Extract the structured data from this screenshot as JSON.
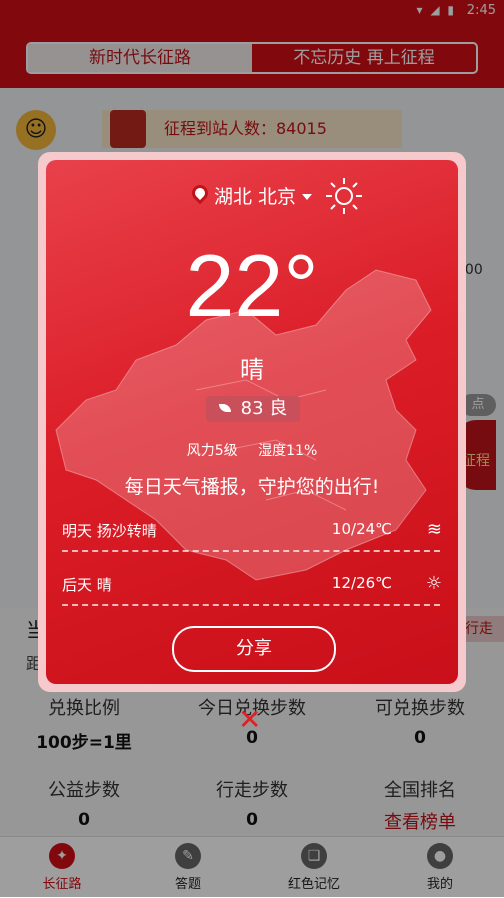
{
  "status_bar": {
    "time": "2:45",
    "icons": "▾ ◢ ▮"
  },
  "header": {
    "tabs": [
      "新时代长征路",
      "不忘历史 再上征程"
    ]
  },
  "background": {
    "arrive_text": "征程到站人数：84015",
    "side_number": "000",
    "side_dot": "点",
    "side_badge": "征程",
    "start_pill": "行走",
    "current_label": "当",
    "distance_label": "距"
  },
  "weather": {
    "location": "湖北 北京",
    "temperature": "22°",
    "condition": "晴",
    "aqi": "83 良",
    "wind": "风力5级",
    "humidity": "湿度11%",
    "slogan": "每日天气播报，守护您的出行!",
    "forecast": [
      {
        "day": "明天  扬沙转晴",
        "range": "10/24℃",
        "icon": "sand-wind-icon"
      },
      {
        "day": "后天  晴",
        "range": "12/26℃",
        "icon": "sun-icon"
      }
    ],
    "share_label": "分享"
  },
  "stats": [
    {
      "label": "兑换比例",
      "value": "100步=1里"
    },
    {
      "label": "今日兑换步数",
      "value": "0"
    },
    {
      "label": "可兑换步数",
      "value": "0"
    },
    {
      "label": "公益步数",
      "value": "0"
    },
    {
      "label": "行走步数",
      "value": "0"
    },
    {
      "label": "全国排名",
      "link": "查看榜单"
    }
  ],
  "tabbar": [
    {
      "label": "长征路",
      "color": "#d10f16"
    },
    {
      "label": "答题",
      "color": "#555555"
    },
    {
      "label": "红色记忆",
      "color": "#555555"
    },
    {
      "label": "我的",
      "color": "#555555"
    }
  ]
}
